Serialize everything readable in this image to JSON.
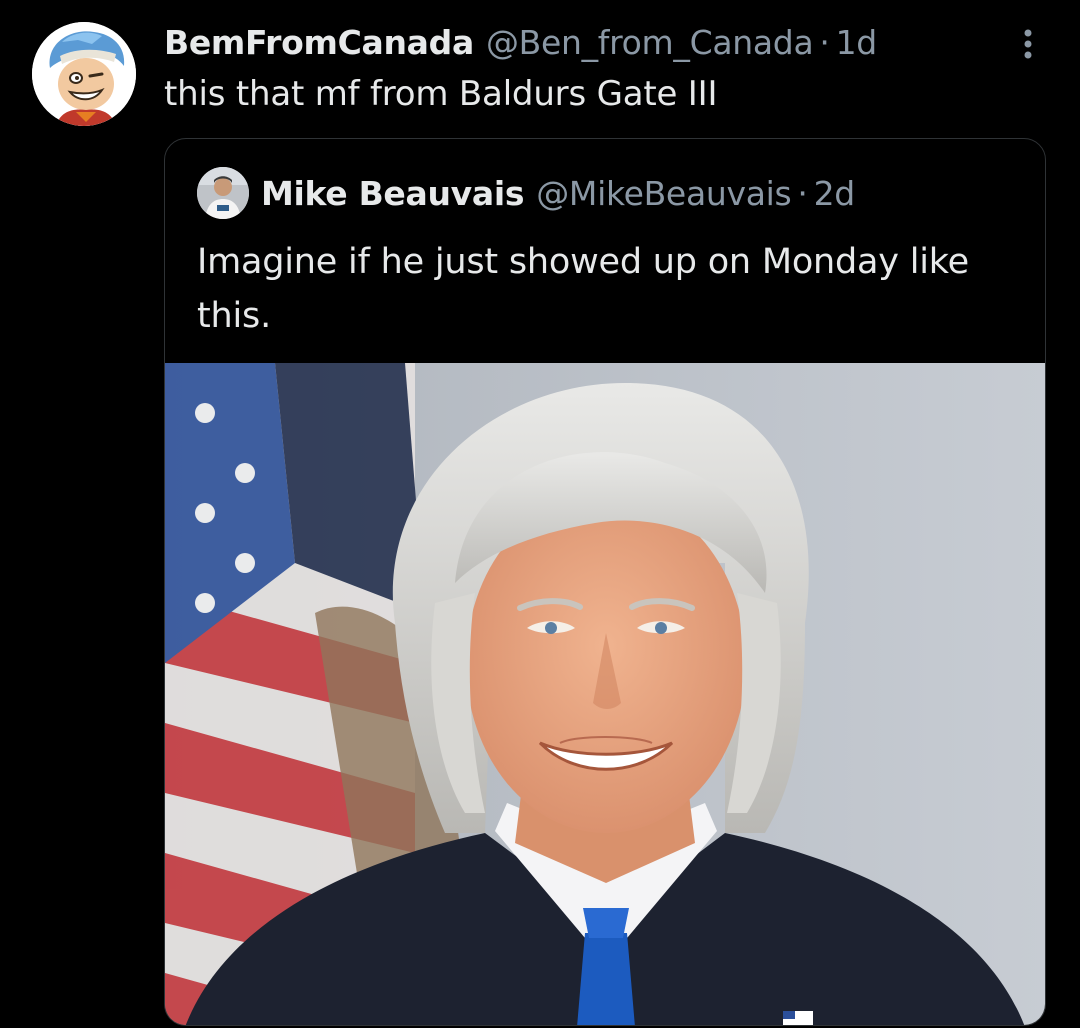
{
  "tweet": {
    "author_name": "BemFromCanada",
    "author_handle": "@Ben_from_Canada",
    "separator": "·",
    "time": "1d",
    "text": "this that mf from Baldurs Gate III"
  },
  "quoted": {
    "author_name": "Mike Beauvais",
    "author_handle": "@MikeBeauvais",
    "separator": "·",
    "time": "2d",
    "text": "Imagine if he just showed up on Monday like this."
  },
  "icons": {
    "more": "more-vertical-icon"
  },
  "colors": {
    "background": "#000000",
    "primary_text": "#e7e9ea",
    "secondary_text": "#8b98a5",
    "border": "#2f3336"
  }
}
